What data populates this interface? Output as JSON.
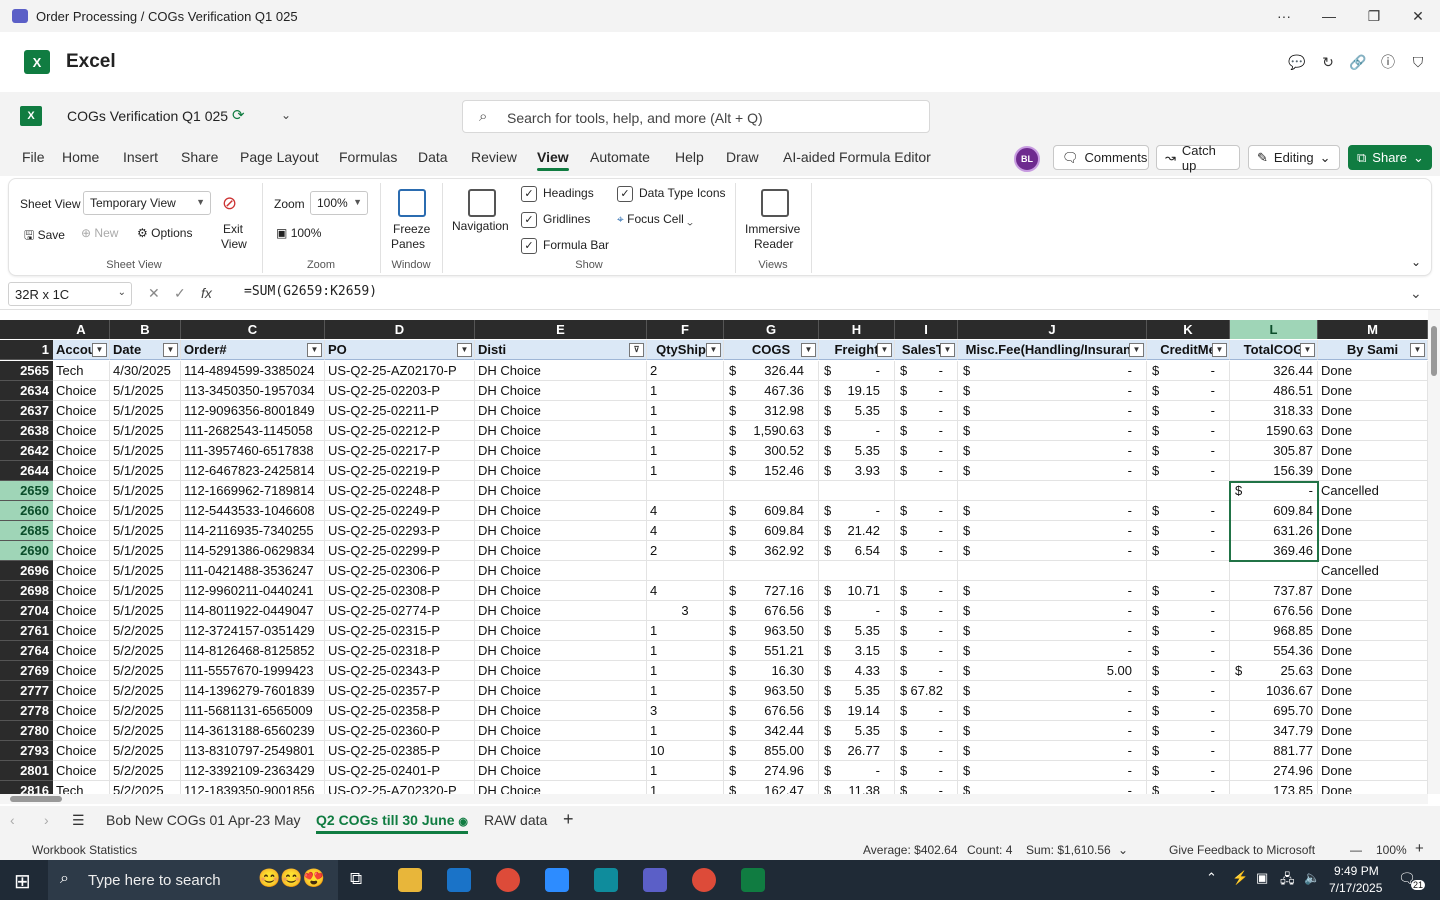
{
  "window": {
    "title": "Order Processing / COGs Verification Q1 025",
    "more": "···",
    "minimize": "—",
    "restore": "❐",
    "close": "✕"
  },
  "app": {
    "logo": "X",
    "name": "Excel"
  },
  "doc": {
    "name": "COGs Verification Q1 025",
    "search_placeholder": "Search for tools, help, and more (Alt + Q)"
  },
  "menu_tabs": [
    "File",
    "Home",
    "Insert",
    "Share",
    "Page Layout",
    "Formulas",
    "Data",
    "Review",
    "View",
    "Automate",
    "Help",
    "Draw",
    "AI-aided Formula Editor"
  ],
  "active_tab": "View",
  "user": {
    "initials": "BL"
  },
  "toolbar": {
    "comments": "Comments",
    "catchup": "Catch up",
    "editing": "Editing",
    "share": "Share"
  },
  "ribbon": {
    "sheet_view_label": "Sheet View",
    "sheet_view_value": "Temporary View",
    "exit_view": [
      "Exit",
      "View"
    ],
    "save": "Save",
    "new": "New",
    "options": "Options",
    "group_sheetview": "Sheet View",
    "zoom_label": "Zoom",
    "zoom_value": "100%",
    "zoom100": "100%",
    "group_zoom": "Zoom",
    "freeze": [
      "Freeze",
      "Panes"
    ],
    "group_window": "Window",
    "navigation": "Navigation",
    "headings": "Headings",
    "gridlines": "Gridlines",
    "formula_bar": "Formula Bar",
    "data_type_icons": "Data Type Icons",
    "focus_cell": "Focus Cell",
    "group_show": "Show",
    "immersive": [
      "Immersive",
      "Reader"
    ],
    "group_views": "Views"
  },
  "formula": {
    "namebox": "32R x 1C",
    "fx": "fx",
    "formula": "=SUM(G2659:K2659)"
  },
  "columns": [
    "A",
    "B",
    "C",
    "D",
    "E",
    "F",
    "G",
    "H",
    "I",
    "J",
    "K",
    "L",
    "M"
  ],
  "header_row": {
    "num": "1",
    "cells": [
      "Accou",
      "Date",
      "Order#",
      "PO",
      "Disti",
      "QtyShipp",
      "COGS",
      "Freight",
      "SalesTa",
      "Misc.Fee(Handling/Insuranc",
      "CreditMe",
      "TotalCOG",
      "By Sami"
    ]
  },
  "rows": [
    {
      "num": "2565",
      "sel": false,
      "a": "Tech",
      "b": "4/30/2025",
      "c": "114-4894599-3385024",
      "d": "US-Q2-25-AZ02170-P",
      "e": "DH Choice",
      "f": "2",
      "gs": "$",
      "g": "326.44",
      "hs": "$",
      "h": "-",
      "is": "$",
      "i": "-",
      "js": "$",
      "j": "-",
      "ks": "$",
      "k": "-",
      "ls": "",
      "l": "326.44",
      "m": "Done"
    },
    {
      "num": "2634",
      "sel": false,
      "a": "Choice",
      "b": "5/1/2025",
      "c": "113-3450350-1957034",
      "d": "US-Q2-25-02203-P",
      "e": "DH Choice",
      "f": "1",
      "gs": "$",
      "g": "467.36",
      "hs": "$",
      "h": "19.15",
      "is": "$",
      "i": "-",
      "js": "$",
      "j": "-",
      "ks": "$",
      "k": "-",
      "ls": "",
      "l": "486.51",
      "m": "Done"
    },
    {
      "num": "2637",
      "sel": false,
      "a": "Choice",
      "b": "5/1/2025",
      "c": "112-9096356-8001849",
      "d": "US-Q2-25-02211-P",
      "e": "DH Choice",
      "f": "1",
      "gs": "$",
      "g": "312.98",
      "hs": "$",
      "h": "5.35",
      "is": "$",
      "i": "-",
      "js": "$",
      "j": "-",
      "ks": "$",
      "k": "-",
      "ls": "",
      "l": "318.33",
      "m": "Done"
    },
    {
      "num": "2638",
      "sel": false,
      "a": "Choice",
      "b": "5/1/2025",
      "c": "111-2682543-1145058",
      "d": "US-Q2-25-02212-P",
      "e": "DH Choice",
      "f": "1",
      "gs": "$",
      "g": "1,590.63",
      "hs": "$",
      "h": "-",
      "is": "$",
      "i": "-",
      "js": "$",
      "j": "-",
      "ks": "$",
      "k": "-",
      "ls": "",
      "l": "1590.63",
      "m": "Done"
    },
    {
      "num": "2642",
      "sel": false,
      "a": "Choice",
      "b": "5/1/2025",
      "c": "111-3957460-6517838",
      "d": "US-Q2-25-02217-P",
      "e": "DH Choice",
      "f": "1",
      "gs": "$",
      "g": "300.52",
      "hs": "$",
      "h": "5.35",
      "is": "$",
      "i": "-",
      "js": "$",
      "j": "-",
      "ks": "$",
      "k": "-",
      "ls": "",
      "l": "305.87",
      "m": "Done"
    },
    {
      "num": "2644",
      "sel": false,
      "a": "Choice",
      "b": "5/1/2025",
      "c": "112-6467823-2425814",
      "d": "US-Q2-25-02219-P",
      "e": "DH Choice",
      "f": "1",
      "gs": "$",
      "g": "152.46",
      "hs": "$",
      "h": "3.93",
      "is": "$",
      "i": "-",
      "js": "$",
      "j": "-",
      "ks": "$",
      "k": "-",
      "ls": "",
      "l": "156.39",
      "m": "Done"
    },
    {
      "num": "2659",
      "sel": true,
      "a": "Choice",
      "b": "5/1/2025",
      "c": "112-1669962-7189814",
      "d": "US-Q2-25-02248-P",
      "e": "DH Choice",
      "f": "",
      "gs": "",
      "g": "",
      "hs": "",
      "h": "",
      "is": "",
      "i": "",
      "js": "",
      "j": "",
      "ks": "",
      "k": "",
      "ls": "$",
      "l": "-",
      "m": "Cancelled"
    },
    {
      "num": "2660",
      "sel": true,
      "a": "Choice",
      "b": "5/1/2025",
      "c": "112-5443533-1046608",
      "d": "US-Q2-25-02249-P",
      "e": "DH Choice",
      "f": "4",
      "gs": "$",
      "g": "609.84",
      "hs": "$",
      "h": "-",
      "is": "$",
      "i": "-",
      "js": "$",
      "j": "-",
      "ks": "$",
      "k": "-",
      "ls": "",
      "l": "609.84",
      "m": "Done"
    },
    {
      "num": "2685",
      "sel": true,
      "a": "Choice",
      "b": "5/1/2025",
      "c": "114-2116935-7340255",
      "d": "US-Q2-25-02293-P",
      "e": "DH Choice",
      "f": "4",
      "gs": "$",
      "g": "609.84",
      "hs": "$",
      "h": "21.42",
      "is": "$",
      "i": "-",
      "js": "$",
      "j": "-",
      "ks": "$",
      "k": "-",
      "ls": "",
      "l": "631.26",
      "m": "Done"
    },
    {
      "num": "2690",
      "sel": true,
      "a": "Choice",
      "b": "5/1/2025",
      "c": "114-5291386-0629834",
      "d": "US-Q2-25-02299-P",
      "e": "DH Choice",
      "f": "2",
      "gs": "$",
      "g": "362.92",
      "hs": "$",
      "h": "6.54",
      "is": "$",
      "i": "-",
      "js": "$",
      "j": "-",
      "ks": "$",
      "k": "-",
      "ls": "",
      "l": "369.46",
      "m": "Done"
    },
    {
      "num": "2696",
      "sel": false,
      "a": "Choice",
      "b": "5/1/2025",
      "c": "111-0421488-3536247",
      "d": "US-Q2-25-02306-P",
      "e": "DH Choice",
      "f": "",
      "gs": "",
      "g": "",
      "hs": "",
      "h": "",
      "is": "",
      "i": "",
      "js": "",
      "j": "",
      "ks": "",
      "k": "",
      "ls": "",
      "l": "",
      "m": "Cancelled"
    },
    {
      "num": "2698",
      "sel": false,
      "a": "Choice",
      "b": "5/1/2025",
      "c": "112-9960211-0440241",
      "d": "US-Q2-25-02308-P",
      "e": "DH Choice",
      "f": "4",
      "gs": "$",
      "g": "727.16",
      "hs": "$",
      "h": "10.71",
      "is": "$",
      "i": "-",
      "js": "$",
      "j": "-",
      "ks": "$",
      "k": "-",
      "ls": "",
      "l": "737.87",
      "m": "Done"
    },
    {
      "num": "2704",
      "sel": false,
      "a": "Choice",
      "b": "5/1/2025",
      "c": "114-8011922-0449047",
      "d": "US-Q2-25-02774-P",
      "e": "DH Choice",
      "f": "3",
      "fc": true,
      "gs": "$",
      "g": "676.56",
      "hs": "$",
      "h": "-",
      "is": "$",
      "i": "-",
      "js": "$",
      "j": "-",
      "ks": "$",
      "k": "-",
      "ls": "",
      "l": "676.56",
      "m": "Done"
    },
    {
      "num": "2761",
      "sel": false,
      "a": "Choice",
      "b": "5/2/2025",
      "c": "112-3724157-0351429",
      "d": "US-Q2-25-02315-P",
      "e": "DH Choice",
      "f": "1",
      "gs": "$",
      "g": "963.50",
      "hs": "$",
      "h": "5.35",
      "is": "$",
      "i": "-",
      "js": "$",
      "j": "-",
      "ks": "$",
      "k": "-",
      "ls": "",
      "l": "968.85",
      "m": "Done"
    },
    {
      "num": "2764",
      "sel": false,
      "a": "Choice",
      "b": "5/2/2025",
      "c": "114-8126468-8125852",
      "d": "US-Q2-25-02318-P",
      "e": "DH Choice",
      "f": "1",
      "gs": "$",
      "g": "551.21",
      "hs": "$",
      "h": "3.15",
      "is": "$",
      "i": "-",
      "js": "$",
      "j": "-",
      "ks": "$",
      "k": "-",
      "ls": "",
      "l": "554.36",
      "m": "Done"
    },
    {
      "num": "2769",
      "sel": false,
      "a": "Choice",
      "b": "5/2/2025",
      "c": "111-5557670-1999423",
      "d": "US-Q2-25-02343-P",
      "e": "DH Choice",
      "f": "1",
      "gs": "$",
      "g": "16.30",
      "hs": "$",
      "h": "4.33",
      "is": "$",
      "i": "-",
      "js": "$",
      "j": "5.00",
      "ks": "$",
      "k": "-",
      "ls": "$",
      "l": "25.63",
      "m": "Done"
    },
    {
      "num": "2777",
      "sel": false,
      "a": "Choice",
      "b": "5/2/2025",
      "c": "114-1396279-7601839",
      "d": "US-Q2-25-02357-P",
      "e": "DH Choice",
      "f": "1",
      "gs": "$",
      "g": "963.50",
      "hs": "$",
      "h": "5.35",
      "is": "$",
      "i": "67.82",
      "js": "$",
      "j": "-",
      "ks": "$",
      "k": "-",
      "ls": "",
      "l": "1036.67",
      "m": "Done"
    },
    {
      "num": "2778",
      "sel": false,
      "a": "Choice",
      "b": "5/2/2025",
      "c": "111-5681131-6565009",
      "d": "US-Q2-25-02358-P",
      "e": "DH Choice",
      "f": "3",
      "gs": "$",
      "g": "676.56",
      "hs": "$",
      "h": "19.14",
      "is": "$",
      "i": "-",
      "js": "$",
      "j": "-",
      "ks": "$",
      "k": "-",
      "ls": "",
      "l": "695.70",
      "m": "Done"
    },
    {
      "num": "2780",
      "sel": false,
      "a": "Choice",
      "b": "5/2/2025",
      "c": "114-3613188-6560239",
      "d": "US-Q2-25-02360-P",
      "e": "DH Choice",
      "f": "1",
      "gs": "$",
      "g": "342.44",
      "hs": "$",
      "h": "5.35",
      "is": "$",
      "i": "-",
      "js": "$",
      "j": "-",
      "ks": "$",
      "k": "-",
      "ls": "",
      "l": "347.79",
      "m": "Done"
    },
    {
      "num": "2793",
      "sel": false,
      "a": "Choice",
      "b": "5/2/2025",
      "c": "113-8310797-2549801",
      "d": "US-Q2-25-02385-P",
      "e": "DH Choice",
      "f": "10",
      "gs": "$",
      "g": "855.00",
      "hs": "$",
      "h": "26.77",
      "is": "$",
      "i": "-",
      "js": "$",
      "j": "-",
      "ks": "$",
      "k": "-",
      "ls": "",
      "l": "881.77",
      "m": "Done"
    },
    {
      "num": "2801",
      "sel": false,
      "a": "Choice",
      "b": "5/2/2025",
      "c": "112-3392109-2363429",
      "d": "US-Q2-25-02401-P",
      "e": "DH Choice",
      "f": "1",
      "gs": "$",
      "g": "274.96",
      "hs": "$",
      "h": "-",
      "is": "$",
      "i": "-",
      "js": "$",
      "j": "-",
      "ks": "$",
      "k": "-",
      "ls": "",
      "l": "274.96",
      "m": "Done"
    },
    {
      "num": "2816",
      "sel": false,
      "a": "Tech",
      "b": "5/2/2025",
      "c": "112-1839350-9001856",
      "d": "US-Q2-25-AZ02320-P",
      "e": "DH Choice",
      "f": "1",
      "gs": "$",
      "g": "162.47",
      "hs": "$",
      "h": "11.38",
      "is": "$",
      "i": "-",
      "js": "$",
      "j": "-",
      "ks": "$",
      "k": "-",
      "ls": "",
      "l": "173.85",
      "m": "Done"
    }
  ],
  "sheets": [
    "Bob New COGs 01 Apr-23 May",
    "Q2 COGs till 30 June",
    "RAW data"
  ],
  "active_sheet": "Q2 COGs till 30 June",
  "status": {
    "left": "Workbook Statistics",
    "average": "Average: $402.64",
    "count": "Count: 4",
    "sum": "Sum: $1,610.56",
    "feedback": "Give Feedback to Microsoft",
    "zoom": "100%"
  },
  "taskbar": {
    "search": "Type here to search",
    "time": "9:49 PM",
    "date": "7/17/2025",
    "notif": "21"
  }
}
